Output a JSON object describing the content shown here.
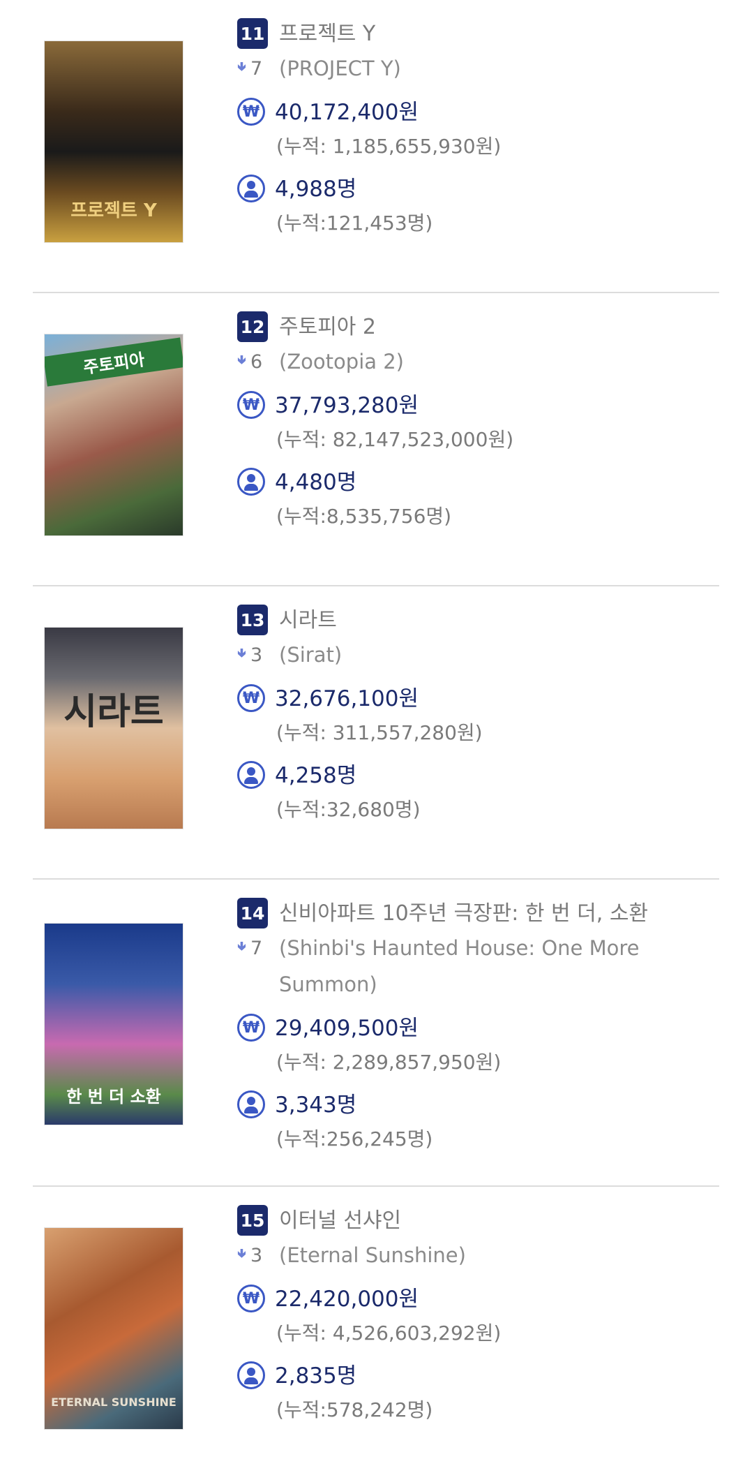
{
  "movies": [
    {
      "rank": "11",
      "title": "프로젝트 Y",
      "rank_change": "7",
      "subtitle": "(PROJECT Y)",
      "revenue": "40,172,400원",
      "cum_revenue": "(누적: 1,185,655,930원)",
      "audience": "4,988명",
      "cum_audience": "(누적:121,453명)",
      "poster_text": "프로젝트 Y",
      "poster_colors": [
        "#7a5a2a",
        "#2a2a2a",
        "#c99a3a"
      ]
    },
    {
      "rank": "12",
      "title": "주토피아 2",
      "rank_change": "6",
      "subtitle": "(Zootopia 2)",
      "revenue": "37,793,280원",
      "cum_revenue": "(누적: 82,147,523,000원)",
      "audience": "4,480명",
      "cum_audience": "(누적:8,535,756명)",
      "poster_text": "주토피아",
      "poster_colors": [
        "#6aa0c8",
        "#c8786a",
        "#3a5a3a"
      ]
    },
    {
      "rank": "13",
      "title": "시라트",
      "rank_change": "3",
      "subtitle": "(Sirat)",
      "revenue": "32,676,100원",
      "cum_revenue": "(누적: 311,557,280원)",
      "audience": "4,258명",
      "cum_audience": "(누적:32,680명)",
      "poster_text": "시라트",
      "poster_colors": [
        "#4a4a52",
        "#d8a878",
        "#c89060"
      ]
    },
    {
      "rank": "14",
      "title": "신비아파트 10주년 극장판: 한 번 더, 소환",
      "rank_change": "7",
      "subtitle": "(Shinbi's Haunted House: One More Summon)",
      "revenue": "29,409,500원",
      "cum_revenue": "(누적: 2,289,857,950원)",
      "audience": "3,343명",
      "cum_audience": "(누적:256,245명)",
      "poster_text": "한 번 더 소환",
      "poster_colors": [
        "#1a3a7a",
        "#c85aa8",
        "#3a8a3a"
      ]
    },
    {
      "rank": "15",
      "title": "이터널 선샤인",
      "rank_change": "3",
      "subtitle": "(Eternal Sunshine)",
      "revenue": "22,420,000원",
      "cum_revenue": "(누적: 4,526,603,292원)",
      "audience": "2,835명",
      "cum_audience": "(누적:578,242명)",
      "poster_text": "ETERNAL SUNSHINE",
      "poster_colors": [
        "#c8784a",
        "#8a4a2a",
        "#4a6a7a"
      ]
    }
  ],
  "icons": {
    "rank_down": "arrow-down-icon",
    "revenue": "won-icon",
    "audience": "person-icon"
  },
  "colors": {
    "rank_badge": "#1b2a6b",
    "icon": "#3a57c4",
    "value_text": "#1b2a6b",
    "muted_text": "#7a7a7a"
  }
}
